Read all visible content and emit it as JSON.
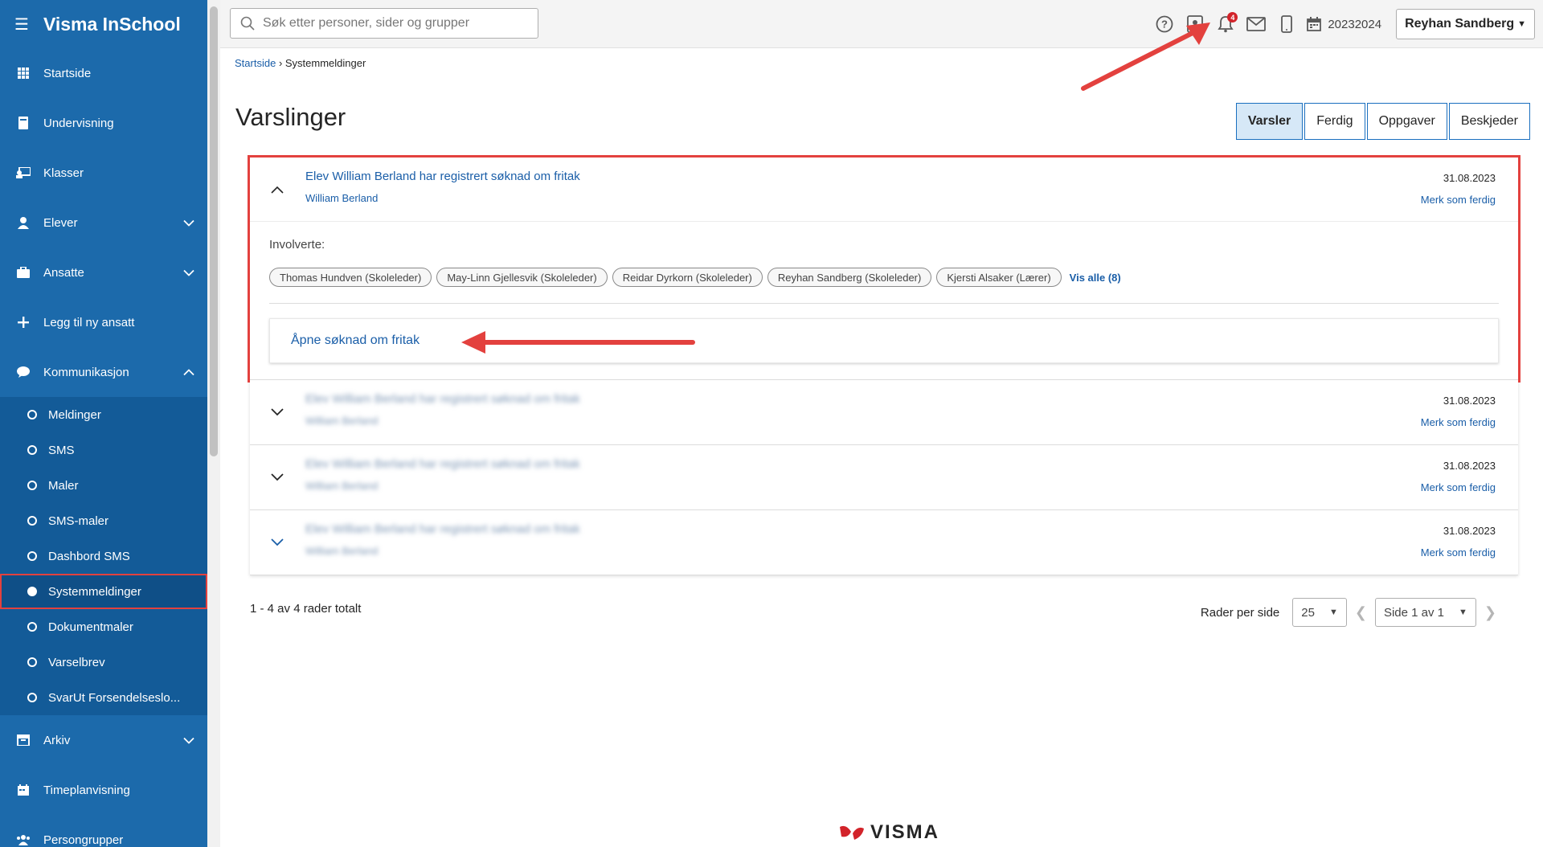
{
  "app": {
    "title": "Visma InSchool"
  },
  "sidebar": {
    "items": [
      {
        "label": "Startside"
      },
      {
        "label": "Undervisning"
      },
      {
        "label": "Klasser"
      },
      {
        "label": "Elever"
      },
      {
        "label": "Ansatte"
      },
      {
        "label": "Legg til ny ansatt"
      },
      {
        "label": "Kommunikasjon"
      }
    ],
    "sub_items": [
      {
        "label": "Meldinger"
      },
      {
        "label": "SMS"
      },
      {
        "label": "Maler"
      },
      {
        "label": "SMS-maler"
      },
      {
        "label": "Dashbord SMS"
      },
      {
        "label": "Systemmeldinger"
      },
      {
        "label": "Dokumentmaler"
      },
      {
        "label": "Varselbrev"
      },
      {
        "label": "SvarUt Forsendelseslo..."
      }
    ],
    "bottom_items": [
      {
        "label": "Arkiv"
      },
      {
        "label": "Timeplanvisning"
      },
      {
        "label": "Persongrupper"
      }
    ]
  },
  "topbar": {
    "search_placeholder": "Søk etter personer, sider og grupper",
    "notification_count": "4",
    "school_year": "20232024",
    "user_name": "Reyhan Sandberg"
  },
  "breadcrumb": {
    "home": "Startside",
    "current": "Systemmeldinger"
  },
  "page": {
    "title": "Varslinger"
  },
  "tabs": [
    {
      "label": "Varsler",
      "active": true
    },
    {
      "label": "Ferdig"
    },
    {
      "label": "Oppgaver"
    },
    {
      "label": "Beskjeder"
    }
  ],
  "notifications": [
    {
      "title": "Elev William Berland har registrert søknad om fritak",
      "student": "William Berland",
      "date": "31.08.2023",
      "mark_done": "Merk som ferdig",
      "involved_label": "Involverte:",
      "involved": [
        "Thomas Hundven (Skoleleder)",
        "May-Linn Gjellesvik (Skoleleder)",
        "Reidar Dyrkorn (Skoleleder)",
        "Reyhan Sandberg (Skoleleder)",
        "Kjersti Alsaker (Lærer)"
      ],
      "show_all": "Vis alle (8)",
      "open_link": "Åpne søknad om fritak"
    },
    {
      "title": "Elev William Berland har registrert søknad om fritak",
      "student": "William Berland",
      "date": "31.08.2023",
      "mark_done": "Merk som ferdig"
    },
    {
      "title": "Elev William Berland har registrert søknad om fritak",
      "student": "William Berland",
      "date": "31.08.2023",
      "mark_done": "Merk som ferdig"
    },
    {
      "title": "Elev William Berland har registrert søknad om fritak",
      "student": "William Berland",
      "date": "31.08.2023",
      "mark_done": "Merk som ferdig"
    }
  ],
  "footer": {
    "count_text": "1 - 4 av 4 rader totalt",
    "rows_per_page_label": "Rader per side",
    "rows_per_page": "25",
    "page_select": "Side 1 av 1"
  },
  "logo": {
    "text": "VISMA"
  },
  "colors": {
    "sidebar": "#1c6aab",
    "accent": "#1a5ea8",
    "highlight": "#e3413e",
    "badge": "#d2232a"
  }
}
